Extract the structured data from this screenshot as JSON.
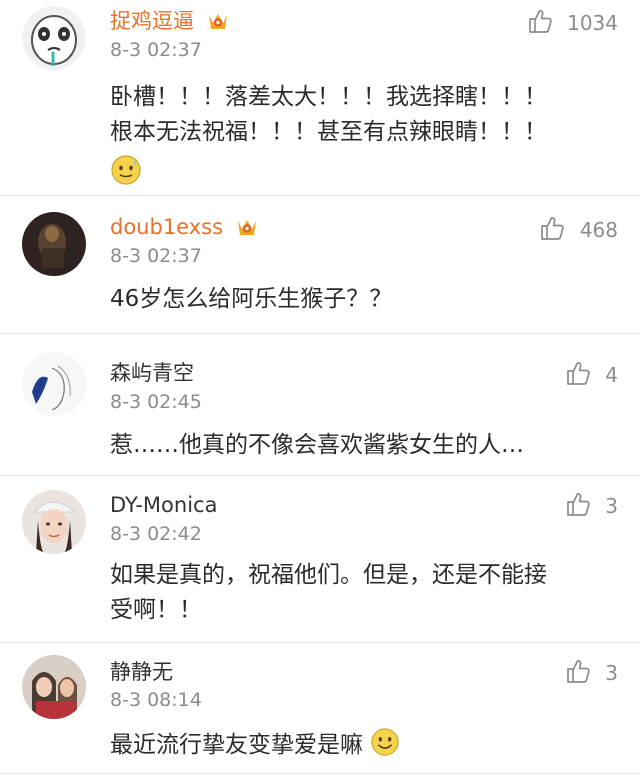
{
  "comments": [
    {
      "user": "捉鸡逗逼",
      "vip": true,
      "avatar": "panda-meme-avatar",
      "time": "8-3 02:37",
      "likes": "1034",
      "lines": [
        "卧槽！！！落差太大！！！我选择瞎！！！",
        "根本无法祝福！！！甚至有点辣眼睛！！！"
      ],
      "emoji": "sweat-smile-emoji"
    },
    {
      "user": "doub1exss",
      "vip": true,
      "avatar": "dark-photo-avatar",
      "time": "8-3 02:37",
      "likes": "468",
      "lines": [
        "46岁怎么给阿乐生猴子？？"
      ]
    },
    {
      "user": "森屿青空",
      "vip": false,
      "avatar": "sketch-avatar",
      "time": "8-3 02:45",
      "likes": "4",
      "lines": [
        "惹……他真的不像会喜欢酱紫女生的人…"
      ]
    },
    {
      "user": "DY-Monica",
      "vip": false,
      "avatar": "girl-photo-avatar",
      "time": "8-3 02:42",
      "likes": "3",
      "lines": [
        "如果是真的，祝福他们。但是，还是不能接",
        "受啊！！"
      ]
    },
    {
      "user": "静静无",
      "vip": false,
      "avatar": "girls-photo-avatar",
      "time": "8-3 08:14",
      "likes": "3",
      "lines": [
        "最近流行挚友变挚爱是嘛"
      ],
      "emoji": "smile-emoji"
    }
  ]
}
